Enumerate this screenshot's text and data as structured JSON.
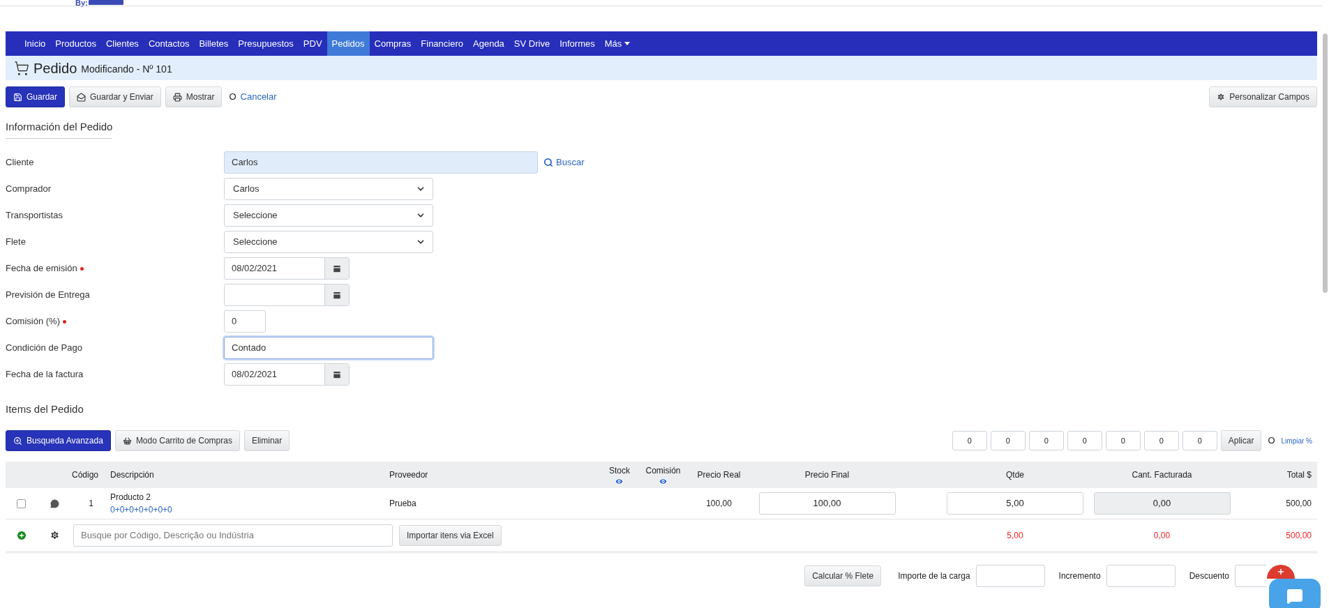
{
  "brand": {
    "byline": "By:"
  },
  "nav": [
    {
      "label": "Inicio",
      "selected": false,
      "kind": "link"
    },
    {
      "label": "Productos",
      "selected": false,
      "kind": "link"
    },
    {
      "label": "Clientes",
      "selected": false,
      "kind": "link"
    },
    {
      "label": "Contactos",
      "selected": false,
      "kind": "link"
    },
    {
      "label": "Billetes",
      "selected": false,
      "kind": "link"
    },
    {
      "label": "Presupuestos",
      "selected": false,
      "kind": "link"
    },
    {
      "label": "PDV",
      "selected": false,
      "kind": "link"
    },
    {
      "label": "Pedidos",
      "selected": true,
      "kind": "link"
    },
    {
      "label": "Compras",
      "selected": false,
      "kind": "link"
    },
    {
      "label": "Financiero",
      "selected": false,
      "kind": "link"
    },
    {
      "label": "Agenda",
      "selected": false,
      "kind": "link"
    },
    {
      "label": "SV Drive",
      "selected": false,
      "kind": "link"
    },
    {
      "label": "Informes",
      "selected": false,
      "kind": "link"
    },
    {
      "label": "Más",
      "selected": false,
      "kind": "dropdown"
    }
  ],
  "page_header": {
    "title": "Pedido",
    "subtitle": "Modificando - Nº 101"
  },
  "toolbar": {
    "buttons": [
      {
        "label": "Guardar",
        "kind": "primary"
      },
      {
        "label": "Guardar y Enviar",
        "kind": "default"
      },
      {
        "label": "Mostrar",
        "kind": "default"
      }
    ],
    "separator": "O",
    "cancel": "Cancelar",
    "customize": "Personalizar Campos"
  },
  "info_section": {
    "title": "Información del Pedido"
  },
  "fields": [
    {
      "label": "Cliente",
      "kind": "lookup",
      "value": "Carlos",
      "required": false,
      "focused": false,
      "action": "Buscar"
    },
    {
      "label": "Comprador",
      "kind": "select",
      "value": "Carlos",
      "required": false,
      "focused": false
    },
    {
      "label": "Transportistas",
      "kind": "select",
      "value": "Seleccione",
      "required": false,
      "focused": false
    },
    {
      "label": "Flete",
      "kind": "select",
      "value": "Seleccione",
      "required": false,
      "focused": false
    },
    {
      "label": "Fecha de emisión",
      "kind": "date",
      "value": "08/02/2021",
      "required": true,
      "focused": false
    },
    {
      "label": "Previsión de Entrega",
      "kind": "date",
      "required": false,
      "focused": false
    },
    {
      "label": "Comisión (%)",
      "kind": "small",
      "value": "0",
      "required": true,
      "focused": false
    },
    {
      "label": "Condición de Pago",
      "kind": "text",
      "value": "Contado",
      "required": false,
      "focused": true
    },
    {
      "label": "Fecha de la factura",
      "kind": "date",
      "value": "08/02/2021",
      "required": false,
      "focused": false
    }
  ],
  "items_section": {
    "title": "Items del Pedido",
    "buttons": [
      {
        "label": "Busqueda Avanzada",
        "kind": "primary"
      },
      {
        "label": "Modo Carrito de Compras",
        "kind": "default"
      },
      {
        "label": "Eliminar",
        "kind": "default"
      }
    ],
    "discounts": [
      "0",
      "0",
      "0",
      "0",
      "0",
      "0",
      "0"
    ],
    "apply": "Aplicar",
    "separator": "O",
    "clear": "Limpiar %"
  },
  "table": {
    "columns": [
      {
        "label": "Código",
        "eye": false
      },
      {
        "label": "Descripción",
        "eye": false
      },
      {
        "label": "Proveedor",
        "eye": false
      },
      {
        "label": "Stock",
        "eye": true
      },
      {
        "label": "Comisión",
        "eye": true
      },
      {
        "label": "Precio Real",
        "eye": false
      },
      {
        "label": "Precio Final",
        "eye": false
      },
      {
        "label": "Qtde",
        "eye": false
      },
      {
        "label": "Cant. Facturada",
        "eye": false
      },
      {
        "label": "Total $",
        "eye": false
      }
    ],
    "rows": [
      {
        "checked": false,
        "code": "1",
        "description": "Producto 2",
        "detail": "0+0+0+0+0+0+0",
        "supplier": "Prueba",
        "real_price": "100,00",
        "final_price": "100,00",
        "qty": "5,00",
        "invoiced": "0,00",
        "total": "500,00"
      }
    ],
    "add_row": {
      "placeholder": "Busque por Código, Descrição ou Indústria",
      "import": "Importar itens via Excel"
    },
    "totals": {
      "qty": "5,00",
      "invoiced": "0,00",
      "total": "500,00"
    }
  },
  "footer": {
    "button": "Calcular % Flete",
    "fields": [
      "Importe de la carga",
      "Incremento",
      "Descuento"
    ]
  }
}
